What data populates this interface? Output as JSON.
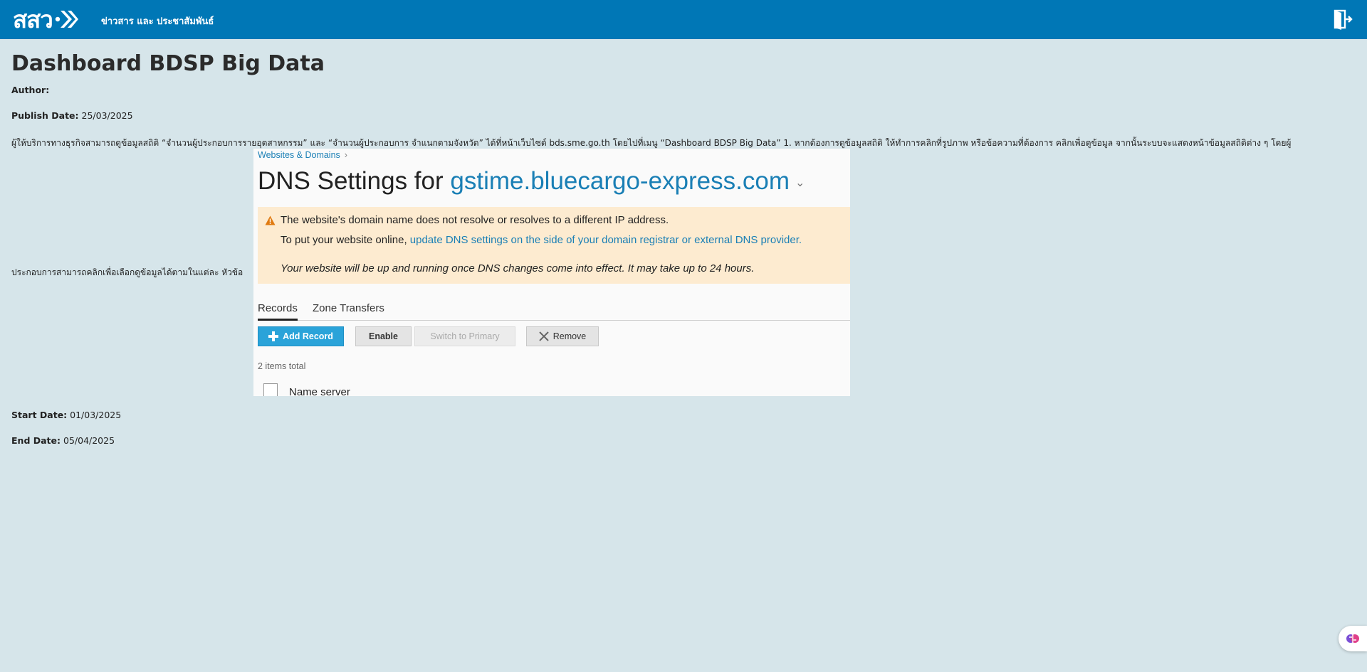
{
  "header": {
    "logo_text": "สสว",
    "nav_link": "ข่าวสาร และ ประชาสัมพันธ์",
    "brand_color": "#0077b6",
    "exit_icon": "logout-door-icon"
  },
  "article": {
    "title": "Dashboard BDSP Big Data",
    "author_label": "Author:",
    "author_value": "",
    "publish_label": "Publish Date:",
    "publish_value": "25/03/2025",
    "description": "ผู้ให้บริการทางธุรกิจสามารถดูข้อมูลสถิติ “จำนวนผู้ประกอบการรายอุตสาหกรรม” และ “จำนวนผู้ประกอบการ จำแนกตามจังหวัด” ได้ที่หน้าเว็บไซต์ bds.sme.go.th โดยไปที่เมนู “Dashboard BDSP Big Data” 1. หากต้องการดูข้อมูลสถิติ ให้ทำการคลิกที่รูปภาพ หรือข้อความที่ต้องการ คลิกเพื่อดูข้อมูล จากนั้นระบบจะแสดงหน้าข้อมูลสถิติต่าง ๆ โดยผู้",
    "description_2": "ประกอบการสามารถคลิกเพื่อเลือกดูข้อมูลได้ตามในแต่ละ หัวข้อ",
    "start_label": "Start Date:",
    "start_value": "01/03/2025",
    "end_label": "End Date:",
    "end_value": "05/04/2025"
  },
  "dns_panel": {
    "breadcrumb": "Websites & Domains",
    "title_prefix": "DNS Settings for",
    "domain": "gstime.bluecargo-express.com",
    "warning": {
      "line1": "The website's domain name does not resolve or resolves to a different IP address.",
      "line2_prefix": "To put your website online,",
      "line2_link": "update DNS settings on the side of your domain registrar or external DNS provider.",
      "line3": "Your website will be up and running once DNS changes come into effect. It may take up to 24 hours.",
      "color": "#fdebd0"
    },
    "tabs": [
      "Records",
      "Zone Transfers"
    ],
    "buttons": {
      "add": "Add Record",
      "enable": "Enable",
      "switch": "Switch to Primary",
      "remove": "Remove"
    },
    "items_total": "2 items total",
    "first_row": "Name server"
  }
}
